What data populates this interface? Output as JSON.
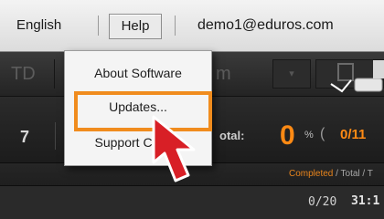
{
  "menubar": {
    "language": "English",
    "help": "Help",
    "user": "demo1@eduros.com"
  },
  "toolbar": {
    "ghost_left": "TD",
    "ghost_mid": "m",
    "ghost_arrow": "▾"
  },
  "stats": {
    "left_number": "7",
    "total_label": "otal:",
    "percent_value": "0",
    "percent_unit": "%",
    "paren": "(",
    "ratio": "0/11"
  },
  "table_header": {
    "completed": "Completed",
    "rest": " / Total / T"
  },
  "row": {
    "count": "0/20",
    "time": "31:1"
  },
  "help_menu": {
    "items": [
      {
        "label": "About Software"
      },
      {
        "label": "Updates..."
      },
      {
        "label": "Support Center"
      }
    ]
  },
  "colors": {
    "accent": "#f08c1e",
    "highlight_box": "#f08c1e",
    "pointer": "#d81f26"
  },
  "icons": {
    "pointer": "hand-pointer-icon",
    "mouse": "mouse-icon"
  }
}
